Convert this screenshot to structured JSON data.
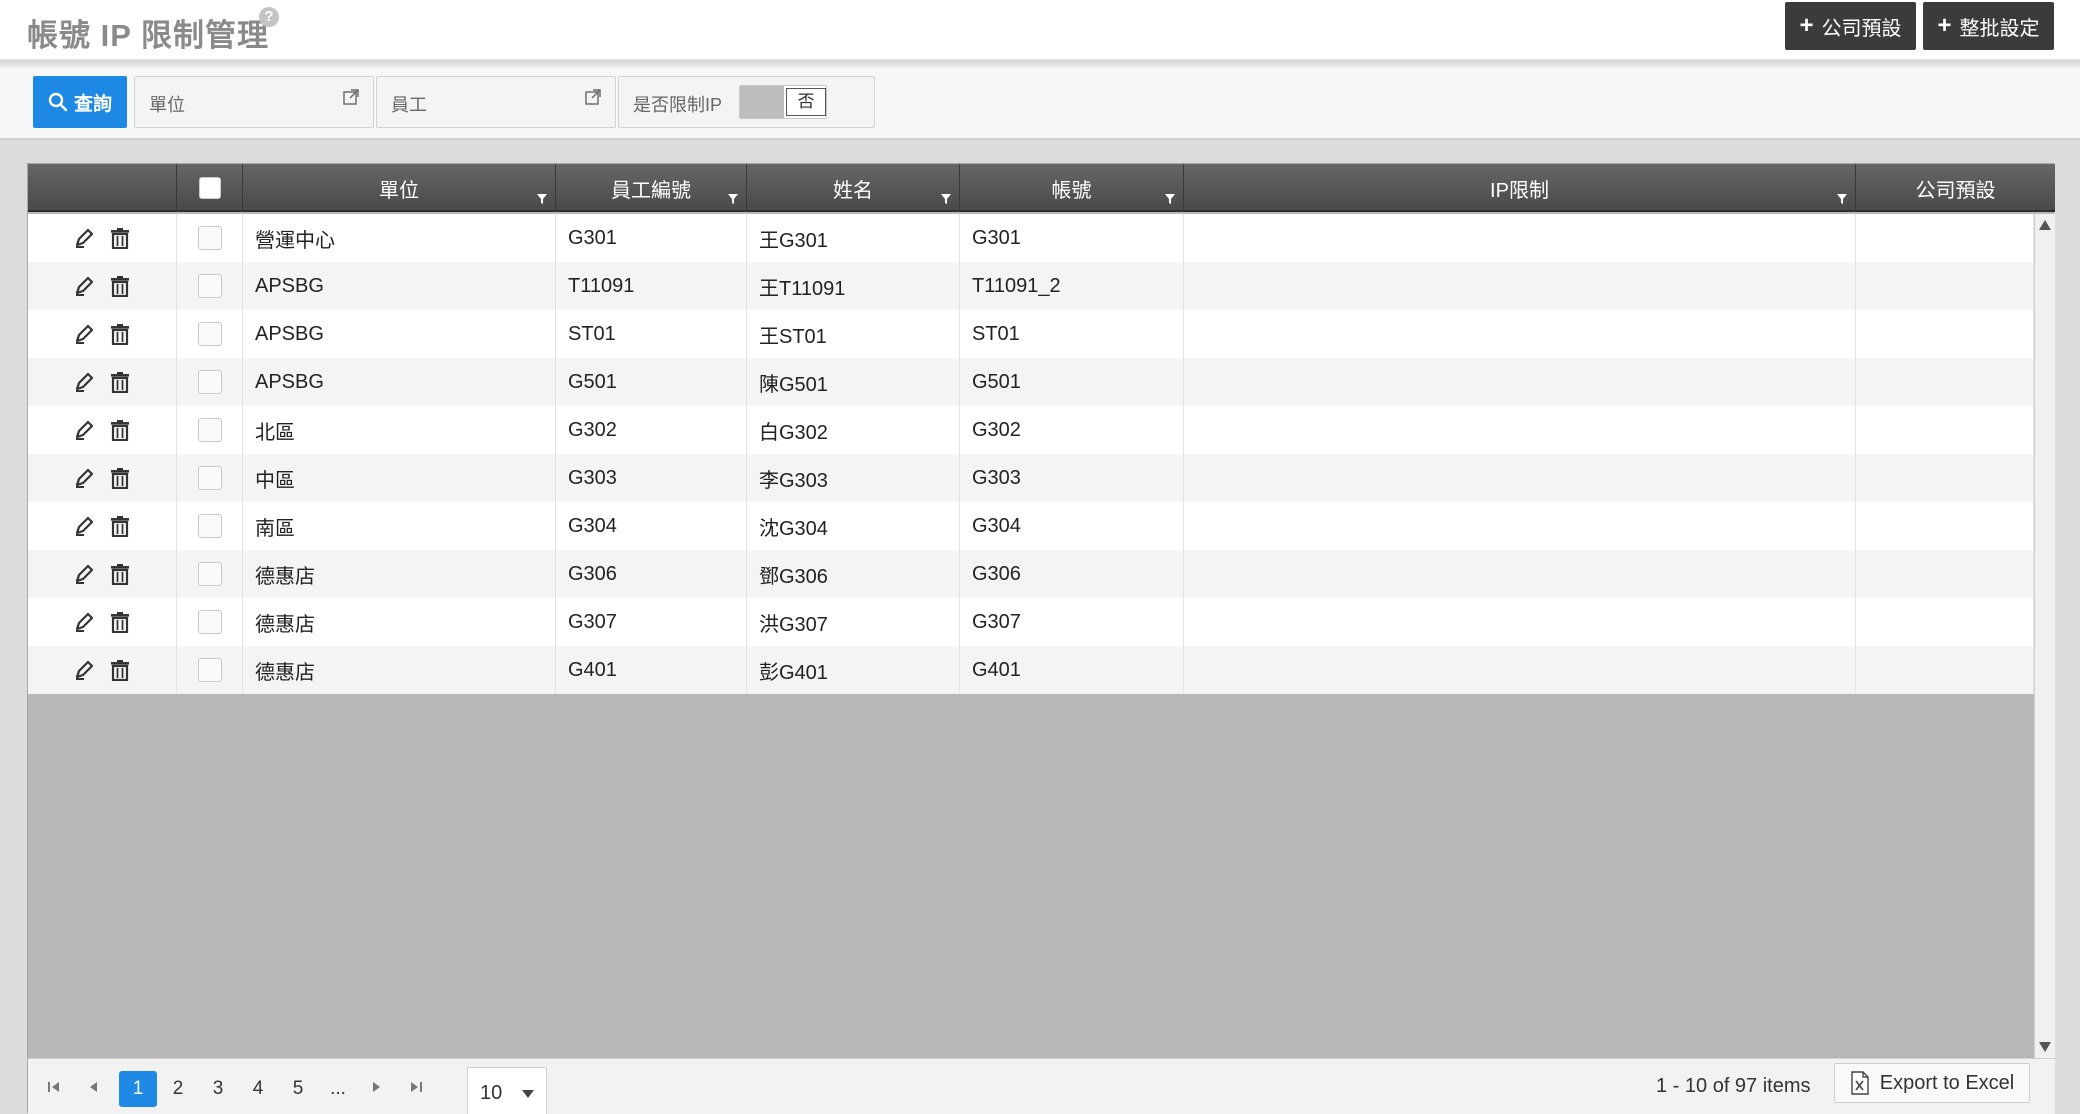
{
  "page": {
    "title": "帳號 IP 限制管理",
    "help_glyph": "?",
    "buttons": {
      "company_default": "公司預設",
      "batch_setting": "整批設定",
      "plus_glyph": "+"
    }
  },
  "filters": {
    "search_label": "查詢",
    "unit_label": "單位",
    "employee_label": "員工",
    "restrict_ip_label": "是否限制IP",
    "restrict_ip_value": "否"
  },
  "grid": {
    "headers": {
      "unit": "單位",
      "employee_no": "員工編號",
      "name": "姓名",
      "account": "帳號",
      "ip_limit": "IP限制",
      "company_default": "公司預設"
    },
    "rows": [
      {
        "unit": "營運中心",
        "employee_no": "G301",
        "name": "王G301",
        "account": "G301",
        "ip_limit": "",
        "company_default": ""
      },
      {
        "unit": "APSBG",
        "employee_no": "T11091",
        "name": "王T11091",
        "account": "T11091_2",
        "ip_limit": "",
        "company_default": ""
      },
      {
        "unit": "APSBG",
        "employee_no": "ST01",
        "name": "王ST01",
        "account": "ST01",
        "ip_limit": "",
        "company_default": ""
      },
      {
        "unit": "APSBG",
        "employee_no": "G501",
        "name": "陳G501",
        "account": "G501",
        "ip_limit": "",
        "company_default": ""
      },
      {
        "unit": "北區",
        "employee_no": "G302",
        "name": "白G302",
        "account": "G302",
        "ip_limit": "",
        "company_default": ""
      },
      {
        "unit": "中區",
        "employee_no": "G303",
        "name": "李G303",
        "account": "G303",
        "ip_limit": "",
        "company_default": ""
      },
      {
        "unit": "南區",
        "employee_no": "G304",
        "name": "沈G304",
        "account": "G304",
        "ip_limit": "",
        "company_default": ""
      },
      {
        "unit": "德惠店",
        "employee_no": "G306",
        "name": "鄧G306",
        "account": "G306",
        "ip_limit": "",
        "company_default": ""
      },
      {
        "unit": "德惠店",
        "employee_no": "G307",
        "name": "洪G307",
        "account": "G307",
        "ip_limit": "",
        "company_default": ""
      },
      {
        "unit": "德惠店",
        "employee_no": "G401",
        "name": "彭G401",
        "account": "G401",
        "ip_limit": "",
        "company_default": ""
      }
    ]
  },
  "pager": {
    "pages": [
      "1",
      "2",
      "3",
      "4",
      "5",
      "..."
    ],
    "current_page": "1",
    "page_size": "10",
    "info": "1 - 10 of 97 items",
    "export_label": "Export to Excel"
  },
  "colors": {
    "accent": "#1e88e5",
    "header_dark": "#3b3b3b",
    "grid_header": "#555555"
  },
  "icons": {
    "row_actions": [
      "edit-icon",
      "trash-icon"
    ],
    "filter": "external-link-icon",
    "column": "filter-icon"
  }
}
